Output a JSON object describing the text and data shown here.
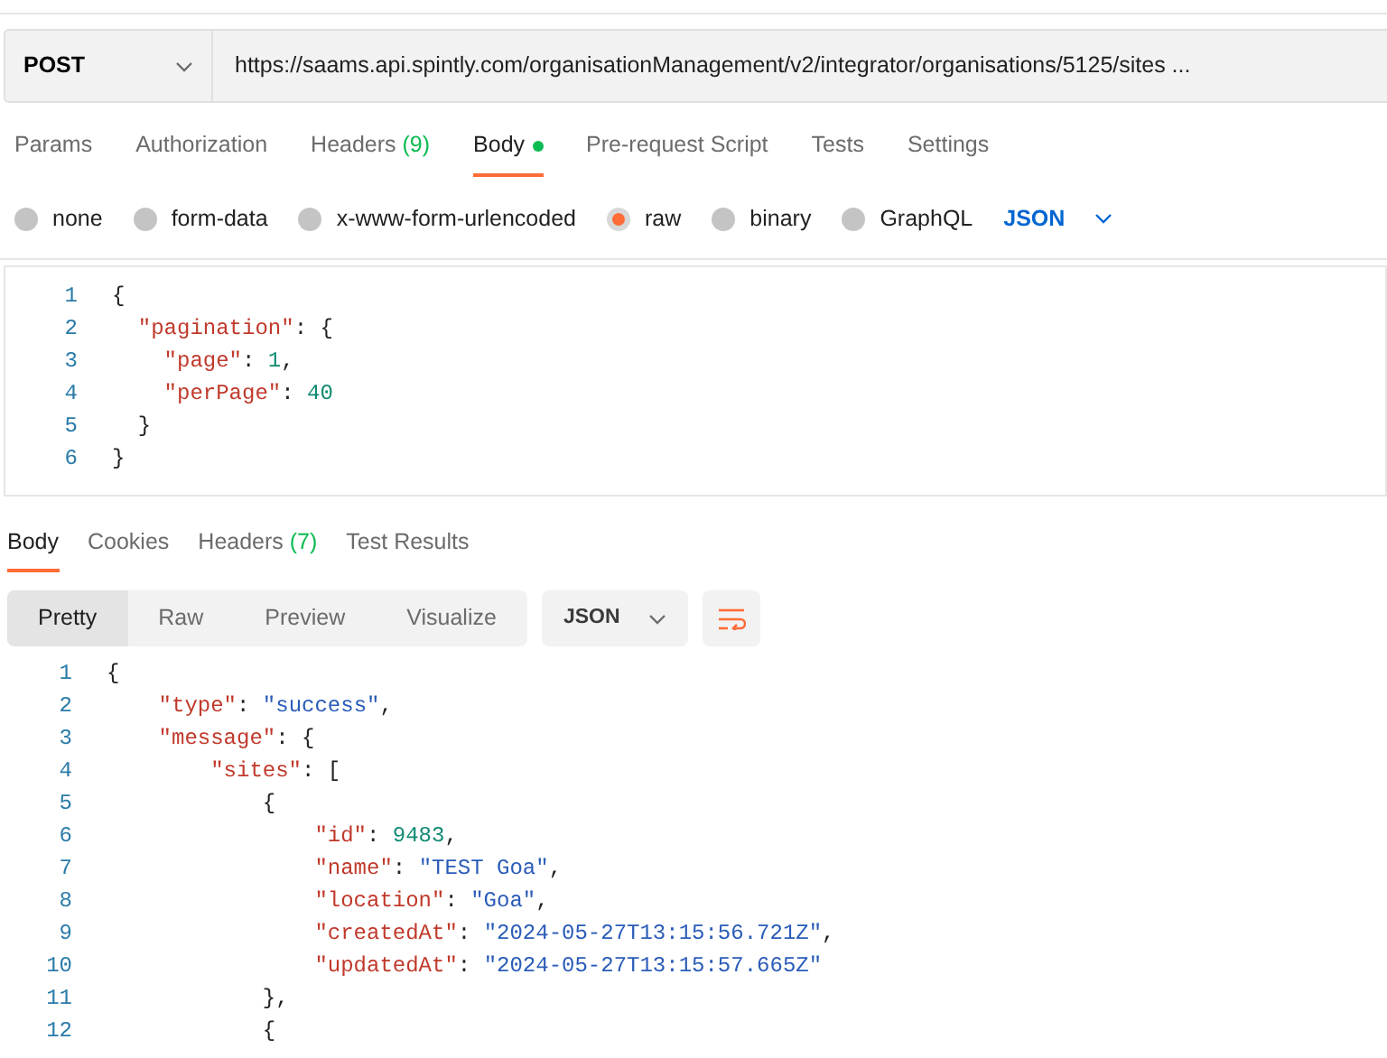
{
  "request": {
    "method": "POST",
    "url": "https://saams.api.spintly.com/organisationManagement/v2/integrator/organisations/5125/sites ..."
  },
  "request_tabs": [
    {
      "label": "Params",
      "selected": false
    },
    {
      "label": "Authorization",
      "selected": false
    },
    {
      "label": "Headers",
      "count": "(9)",
      "selected": false
    },
    {
      "label": "Body",
      "selected": true,
      "dot": true
    },
    {
      "label": "Pre-request Script",
      "selected": false
    },
    {
      "label": "Tests",
      "selected": false
    },
    {
      "label": "Settings",
      "selected": false
    }
  ],
  "body_types": [
    {
      "label": "none",
      "selected": false
    },
    {
      "label": "form-data",
      "selected": false
    },
    {
      "label": "x-www-form-urlencoded",
      "selected": false
    },
    {
      "label": "raw",
      "selected": true
    },
    {
      "label": "binary",
      "selected": false
    },
    {
      "label": "GraphQL",
      "selected": false
    }
  ],
  "body_format": "JSON",
  "request_body": [
    {
      "number": "1",
      "tokens": [
        {
          "kind": "punct",
          "text": "{"
        }
      ]
    },
    {
      "number": "2",
      "tokens": [
        {
          "kind": "key",
          "text": "\"pagination\""
        },
        {
          "kind": "punct",
          "text": ": {"
        }
      ]
    },
    {
      "number": "3",
      "tokens": [
        {
          "kind": "key",
          "text": "\"page\""
        },
        {
          "kind": "punct",
          "text": ": "
        },
        {
          "kind": "num",
          "text": "1"
        },
        {
          "kind": "punct",
          "text": ","
        }
      ]
    },
    {
      "number": "4",
      "tokens": [
        {
          "kind": "key",
          "text": "\"perPage\""
        },
        {
          "kind": "punct",
          "text": ": "
        },
        {
          "kind": "num",
          "text": "40"
        }
      ]
    },
    {
      "number": "5",
      "tokens": [
        {
          "kind": "punct",
          "text": "}"
        }
      ]
    },
    {
      "number": "6",
      "tokens": [
        {
          "kind": "punct",
          "text": "}"
        }
      ]
    }
  ],
  "response_tabs": [
    {
      "label": "Body",
      "selected": true
    },
    {
      "label": "Cookies",
      "selected": false
    },
    {
      "label": "Headers",
      "count": "(7)",
      "selected": false
    },
    {
      "label": "Test Results",
      "selected": false
    }
  ],
  "view_modes": [
    {
      "label": "Pretty",
      "selected": true
    },
    {
      "label": "Raw",
      "selected": false
    },
    {
      "label": "Preview",
      "selected": false
    },
    {
      "label": "Visualize",
      "selected": false
    }
  ],
  "response_format": "JSON",
  "response_body": [
    {
      "number": "1",
      "tokens": [
        {
          "kind": "punct",
          "text": "{"
        }
      ]
    },
    {
      "number": "2",
      "tokens": [
        {
          "kind": "key",
          "text": "\"type\""
        },
        {
          "kind": "punct",
          "text": ": "
        },
        {
          "kind": "str",
          "text": "\"success\""
        },
        {
          "kind": "punct",
          "text": ","
        }
      ]
    },
    {
      "number": "3",
      "tokens": [
        {
          "kind": "key",
          "text": "\"message\""
        },
        {
          "kind": "punct",
          "text": ": {"
        }
      ]
    },
    {
      "number": "4",
      "tokens": [
        {
          "kind": "key",
          "text": "\"sites\""
        },
        {
          "kind": "punct",
          "text": ": ["
        }
      ]
    },
    {
      "number": "5",
      "tokens": [
        {
          "kind": "punct",
          "text": "{"
        }
      ]
    },
    {
      "number": "6",
      "tokens": [
        {
          "kind": "key",
          "text": "\"id\""
        },
        {
          "kind": "punct",
          "text": ": "
        },
        {
          "kind": "num",
          "text": "9483"
        },
        {
          "kind": "punct",
          "text": ","
        }
      ]
    },
    {
      "number": "7",
      "tokens": [
        {
          "kind": "key",
          "text": "\"name\""
        },
        {
          "kind": "punct",
          "text": ": "
        },
        {
          "kind": "str",
          "text": "\"TEST Goa\""
        },
        {
          "kind": "punct",
          "text": ","
        }
      ]
    },
    {
      "number": "8",
      "tokens": [
        {
          "kind": "key",
          "text": "\"location\""
        },
        {
          "kind": "punct",
          "text": ": "
        },
        {
          "kind": "str",
          "text": "\"Goa\""
        },
        {
          "kind": "punct",
          "text": ","
        }
      ]
    },
    {
      "number": "9",
      "tokens": [
        {
          "kind": "key",
          "text": "\"createdAt\""
        },
        {
          "kind": "punct",
          "text": ": "
        },
        {
          "kind": "str",
          "text": "\"2024-05-27T13:15:56.721Z\""
        },
        {
          "kind": "punct",
          "text": ","
        }
      ]
    },
    {
      "number": "10",
      "tokens": [
        {
          "kind": "key",
          "text": "\"updatedAt\""
        },
        {
          "kind": "punct",
          "text": ": "
        },
        {
          "kind": "str",
          "text": "\"2024-05-27T13:15:57.665Z\""
        }
      ]
    },
    {
      "number": "11",
      "tokens": [
        {
          "kind": "punct",
          "text": "},"
        }
      ]
    },
    {
      "number": "12",
      "tokens": [
        {
          "kind": "punct",
          "text": "{"
        }
      ]
    }
  ]
}
